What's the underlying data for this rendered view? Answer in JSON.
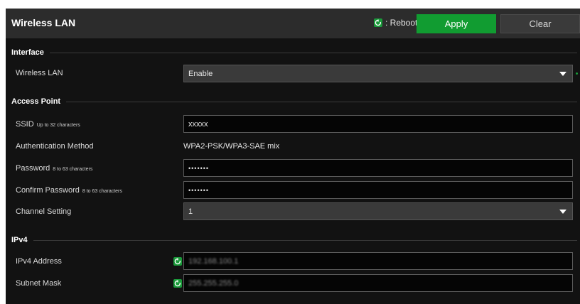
{
  "header": {
    "title": "Wireless LAN",
    "reboot_legend": ": Reboot",
    "apply_label": "Apply",
    "clear_label": "Clear"
  },
  "sections": {
    "interface": "Interface",
    "access_point": "Access Point",
    "ipv4": "IPv4"
  },
  "interface": {
    "wireless_lan_label": "Wireless LAN",
    "wireless_lan_value": "Enable"
  },
  "access_point": {
    "ssid_label": "SSID",
    "ssid_hint": "Up to 32 characters",
    "ssid_value": "xxxxx",
    "auth_label": "Authentication Method",
    "auth_value": "WPA2-PSK/WPA3-SAE mix",
    "password_label": "Password",
    "password_hint": "8 to 63 characters",
    "password_value": "•••••••",
    "confirm_label": "Confirm Password",
    "confirm_hint": "8 to 63 characters",
    "confirm_value": "•••••••",
    "channel_label": "Channel Setting",
    "channel_value": "1"
  },
  "ipv4": {
    "address_label": "IPv4 Address",
    "address_value": "192.168.100.1",
    "subnet_label": "Subnet Mask",
    "subnet_value": "255.255.255.0"
  },
  "colors": {
    "accent_green": "#119c31",
    "background": "#121212",
    "header": "#2c2c2c"
  },
  "icons": {
    "reboot": "reboot-icon",
    "dropdown": "chevron-down-icon"
  }
}
